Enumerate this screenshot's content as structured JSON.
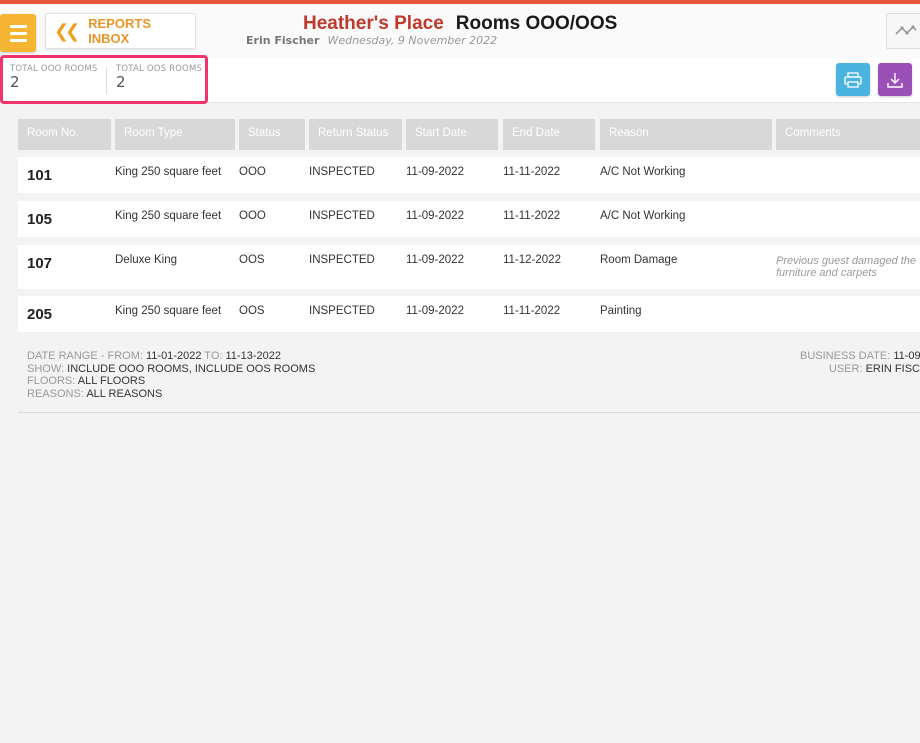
{
  "header": {
    "back_label": "REPORTS INBOX",
    "hotel_name": "Heather's Place",
    "report_name": "Rooms OOO/OOS",
    "user_name": "Erin Fischer",
    "date": "Wednesday, 9 November 2022"
  },
  "totals": {
    "ooo_label": "TOTAL OOO ROOMS",
    "ooo_value": "2",
    "oos_label": "TOTAL OOS ROOMS",
    "oos_value": "2"
  },
  "table": {
    "columns": [
      "Room No.",
      "Room Type",
      "Status",
      "Return Status",
      "Start Date",
      "End Date",
      "Reason",
      "Comments"
    ],
    "rows": [
      {
        "room": "101",
        "type": "King 250 square feet",
        "status": "OOO",
        "return_status": "INSPECTED",
        "start": "11-09-2022",
        "end": "11-11-2022",
        "reason": "A/C Not Working",
        "comment": ""
      },
      {
        "room": "105",
        "type": "King 250 square feet",
        "status": "OOO",
        "return_status": "INSPECTED",
        "start": "11-09-2022",
        "end": "11-11-2022",
        "reason": "A/C Not Working",
        "comment": ""
      },
      {
        "room": "107",
        "type": "Deluxe King",
        "status": "OOS",
        "return_status": "INSPECTED",
        "start": "11-09-2022",
        "end": "11-12-2022",
        "reason": "Room Damage",
        "comment": "Previous guest damaged the furniture and carpets"
      },
      {
        "room": "205",
        "type": "King 250 square feet",
        "status": "OOS",
        "return_status": "INSPECTED",
        "start": "11-09-2022",
        "end": "11-11-2022",
        "reason": "Painting",
        "comment": ""
      }
    ]
  },
  "footer": {
    "date_range_label": "DATE RANGE - FROM:",
    "date_from": "11-01-2022",
    "to_label": "TO:",
    "date_to": "11-13-2022",
    "show_label": "SHOW:",
    "show_value": "INCLUDE OOO ROOMS, INCLUDE OOS ROOMS",
    "floors_label": "FLOORS:",
    "floors_value": "ALL FLOORS",
    "reasons_label": "REASONS:",
    "reasons_value": "ALL REASONS",
    "business_date_label": "BUSINESS DATE:",
    "business_date_value": "11-09-",
    "user_label": "USER:",
    "user_value": "ERIN FISC"
  },
  "icons": {
    "menu": "hamburger-icon",
    "back": "double-chevron-left-icon",
    "graph": "line-graph-icon",
    "print": "printer-icon",
    "download": "download-icon"
  },
  "colors": {
    "accent_bar": "#e8553a",
    "menu_button": "#f5b532",
    "hotel_name": "#c0392b",
    "highlight": "#f0336a",
    "print_button": "#4ab3e0",
    "download_button": "#9b50b8"
  }
}
